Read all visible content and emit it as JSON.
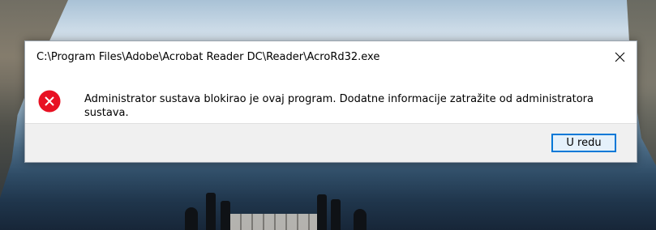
{
  "dialog": {
    "title": "C:\\Program Files\\Adobe\\Acrobat Reader DC\\Reader\\AcroRd32.exe",
    "message": "Administrator sustava blokirao je ovaj program. Dodatne informacije zatražite od administratora sustava.",
    "ok_label": "U redu",
    "icon": "error-icon",
    "colors": {
      "error_icon": "#e81123",
      "button_border": "#0078d7",
      "button_bg": "#e5f1fb",
      "footer_bg": "#f0f0f0"
    }
  }
}
